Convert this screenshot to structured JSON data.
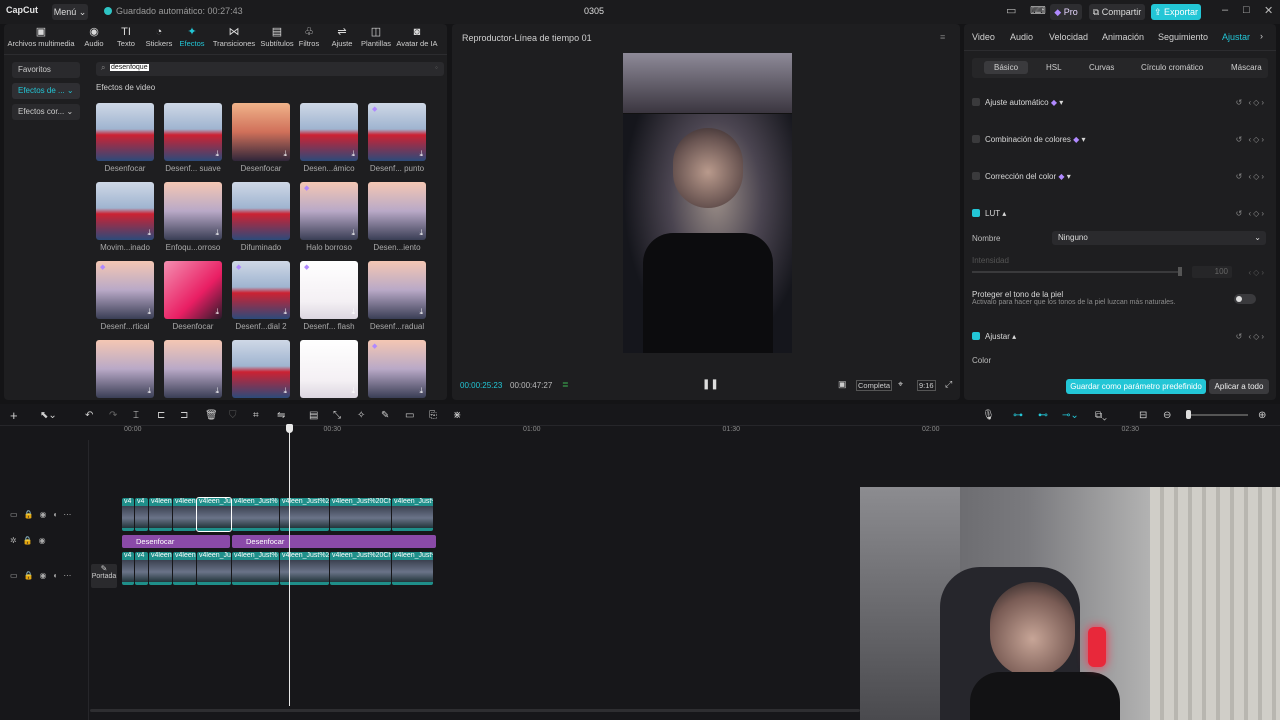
{
  "titlebar": {
    "logo": "CapCut",
    "menu": "Menú ⌄",
    "autosave": "Guardado automático: 00:27:43",
    "project": "0305",
    "pro": "Pro",
    "share": "Compartir",
    "export": "Exportar"
  },
  "toolbar": {
    "items": [
      {
        "icon": "media-icon",
        "label": "Archivos multimedia"
      },
      {
        "icon": "audio-icon",
        "label": "Audio"
      },
      {
        "icon": "text-icon",
        "label": "Texto"
      },
      {
        "icon": "stickers-icon",
        "label": "Stickers"
      },
      {
        "icon": "effects-icon",
        "label": "Efectos"
      },
      {
        "icon": "transitions-icon",
        "label": "Transiciones"
      },
      {
        "icon": "subtitles-icon",
        "label": "Subtítulos"
      },
      {
        "icon": "filters-icon",
        "label": "Filtros"
      },
      {
        "icon": "adjust-icon",
        "label": "Ajuste"
      },
      {
        "icon": "templates-icon",
        "label": "Plantillas"
      },
      {
        "icon": "ai-avatar-icon",
        "label": "Avatar de IA"
      }
    ]
  },
  "sidebar": {
    "items": [
      "Favoritos",
      "Efectos de ... ⌄",
      "Efectos cor... ⌄"
    ]
  },
  "search": {
    "value": "desenfoque"
  },
  "effects": {
    "section_title": "Efectos de video",
    "items": [
      {
        "label": "Desenfocar"
      },
      {
        "label": "Desenf... suave"
      },
      {
        "label": "Desenfocar"
      },
      {
        "label": "Desen...ámico"
      },
      {
        "label": "Desenf... punto"
      },
      {
        "label": "Movim...inado"
      },
      {
        "label": "Enfoqu...orroso"
      },
      {
        "label": "Difuminado"
      },
      {
        "label": "Halo borroso"
      },
      {
        "label": "Desen...iento"
      },
      {
        "label": "Desenf...rtical"
      },
      {
        "label": "Desenfocar"
      },
      {
        "label": "Desenf...dial 2"
      },
      {
        "label": "Desenf... flash"
      },
      {
        "label": "Desenf...radual"
      },
      {
        "label": ""
      },
      {
        "label": ""
      },
      {
        "label": ""
      },
      {
        "label": ""
      },
      {
        "label": ""
      }
    ]
  },
  "player": {
    "title": "Reproductor-Línea de tiempo 01",
    "current_time": "00:00:25:23",
    "total_time": "00:00:47:27",
    "quality": "Completa",
    "ratio": "9:16"
  },
  "right": {
    "tabs": [
      "Video",
      "Audio",
      "Velocidad",
      "Animación",
      "Seguimiento",
      "Ajustar"
    ],
    "subtabs": [
      "Básico",
      "HSL",
      "Curvas",
      "Círculo cromático",
      "Máscara"
    ],
    "rows": {
      "auto": "Ajuste automático",
      "combo": "Combinación de colores",
      "correction": "Corrección del color",
      "lut": "LUT",
      "name_label": "Nombre",
      "name_value": "Ninguno",
      "intensity": "Intensidad",
      "intensity_value": "100",
      "skin_title": "Proteger el tono de la piel",
      "skin_desc": "Activalo para hacer que los tonos de la piel luzcan más naturales.",
      "adjust": "Ajustar",
      "color": "Color"
    },
    "save_preset": "Guardar como parámetro predefinido",
    "apply_all": "Aplicar a todo"
  },
  "timeline": {
    "ticks": [
      "00:00",
      "00:30",
      "01:00",
      "01:30",
      "02:00",
      "02:30"
    ],
    "cover_label": "Portada",
    "fx_clips": [
      "Desenfocar",
      "Desenfocar"
    ],
    "top_clips": [
      "v4",
      "v4",
      "v4leen",
      "v4leen",
      "v4leen_Ju",
      "v4leen_Just%",
      "v4leen_Just%2",
      "v4leen_Just%20Ch",
      "v4leen_Just%"
    ],
    "bottom_clips": [
      "v4",
      "v4",
      "v4leen",
      "v4leen",
      "v4leen_Ju",
      "v4leen_Just%",
      "v4leen_Just%2",
      "v4leen_Just%20Ch",
      "v4leen_Just%"
    ]
  },
  "colors": {
    "accent": "#23c6d6",
    "effect_purple": "#8a4aa8",
    "clip_teal": "#1f8f8a"
  }
}
